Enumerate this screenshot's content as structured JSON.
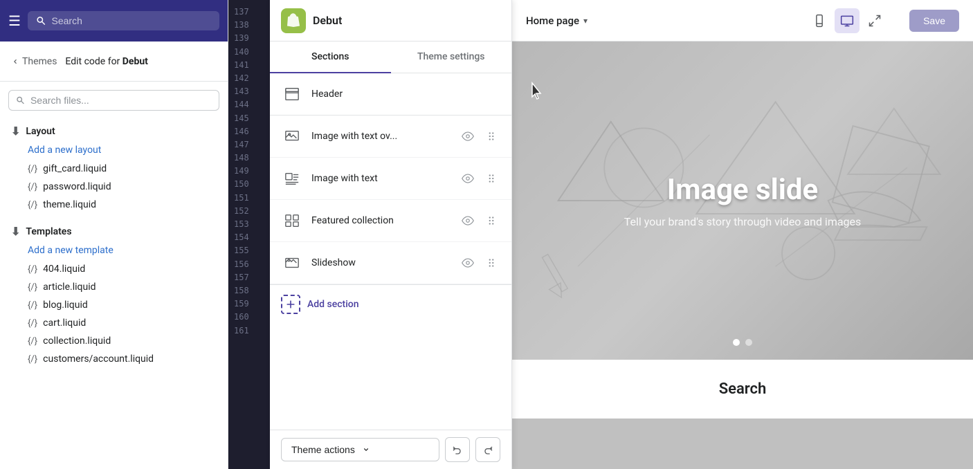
{
  "topbar": {
    "search_placeholder": "Search"
  },
  "breadcrumb": {
    "back_label": "Themes",
    "edit_label": "Edit code for",
    "theme_name": "Debut"
  },
  "file_search": {
    "placeholder": "Search files..."
  },
  "layout_section": {
    "label": "Layout",
    "add_link": "Add a new layout",
    "files": [
      {
        "name": "gift_card.liquid"
      },
      {
        "name": "password.liquid"
      },
      {
        "name": "theme.liquid"
      }
    ]
  },
  "templates_section": {
    "label": "Templates",
    "add_link": "Add a new template",
    "files": [
      {
        "name": "404.liquid"
      },
      {
        "name": "article.liquid"
      },
      {
        "name": "blog.liquid"
      },
      {
        "name": "cart.liquid"
      },
      {
        "name": "collection.liquid"
      },
      {
        "name": "customers/account.liquid"
      }
    ]
  },
  "theme_editor": {
    "theme_name": "Debut",
    "tabs": [
      {
        "label": "Sections",
        "active": true
      },
      {
        "label": "Theme settings",
        "active": false
      }
    ],
    "header_section": {
      "label": "Header",
      "icon": "header"
    },
    "sections": [
      {
        "label": "Image with text ov...",
        "id": "image-text-overlay"
      },
      {
        "label": "Image with text",
        "id": "image-text"
      },
      {
        "label": "Featured collection",
        "id": "featured-collection"
      },
      {
        "label": "Slideshow",
        "id": "slideshow"
      }
    ],
    "add_section_label": "Add section",
    "theme_actions_label": "Theme actions",
    "undo_label": "Undo",
    "redo_label": "Redo"
  },
  "preview": {
    "page_label": "Home page",
    "save_label": "Save",
    "slide_title": "Image slide",
    "slide_subtitle": "Tell your brand's story through video and images",
    "search_section_title": "Search"
  },
  "code_editor": {
    "line_numbers": [
      "137",
      "138",
      "139",
      "140",
      "141",
      "142",
      "143",
      "144",
      "145",
      "146",
      "147",
      "148",
      "149",
      "150",
      "151",
      "152",
      "153",
      "154",
      "155",
      "156",
      "157",
      "158",
      "159",
      "160",
      "161"
    ]
  }
}
